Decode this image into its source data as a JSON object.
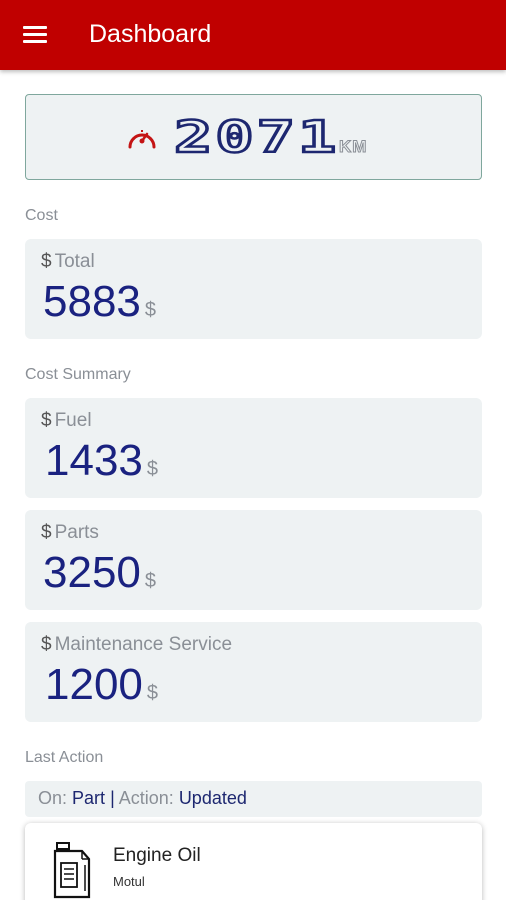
{
  "app_bar": {
    "title": "Dashboard",
    "menu_icon": "hamburger-menu-icon"
  },
  "odometer": {
    "value": "2071",
    "unit": "KM",
    "icon": "speedometer-icon"
  },
  "cost": {
    "label": "Cost",
    "total": {
      "symbol": "$",
      "label": "Total",
      "value": "5883",
      "unit": "$"
    }
  },
  "cost_summary": {
    "label": "Cost Summary",
    "items": [
      {
        "symbol": "$",
        "label": "Fuel",
        "value": "1433",
        "unit": "$"
      },
      {
        "symbol": "$",
        "label": "Parts",
        "value": "3250",
        "unit": "$"
      },
      {
        "symbol": "$",
        "label": "Maintenance Service",
        "value": "1200",
        "unit": "$"
      }
    ]
  },
  "last_action": {
    "label": "Last Action",
    "on_label": "On:",
    "on_value": "Part",
    "separator": "|",
    "action_label": "Action:",
    "action_value": "Updated"
  },
  "part": {
    "name": "Engine Oil",
    "brand": "Motul",
    "icon": "oil-container-icon"
  },
  "colors": {
    "app_bar": "#c00000",
    "value_text": "#1a2280",
    "card_bg": "#eef2f3",
    "label_text": "#8a8f96"
  }
}
